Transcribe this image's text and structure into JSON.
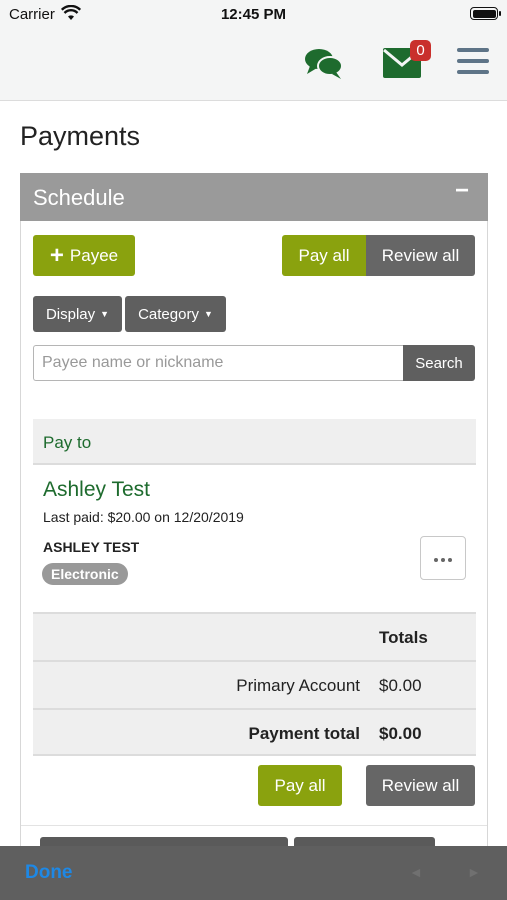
{
  "status_bar": {
    "carrier": "Carrier",
    "time": "12:45 PM"
  },
  "header": {
    "chat_icon": "chat-bubbles-icon",
    "mail_icon": "mail-icon",
    "mail_badge": "0",
    "menu_icon": "hamburger-menu-icon"
  },
  "page": {
    "title": "Payments"
  },
  "panel": {
    "title": "Schedule",
    "collapse_symbol": "−",
    "add_payee_label": "Payee",
    "pay_all_label": "Pay all",
    "review_all_label": "Review all",
    "display_label": "Display",
    "category_label": "Category",
    "search": {
      "placeholder": "Payee name or nickname",
      "button_label": "Search"
    }
  },
  "payees": {
    "header": "Pay to",
    "items": [
      {
        "name": "Ashley Test",
        "last_paid": "Last paid: $20.00 on 12/20/2019",
        "legal_name": "ASHLEY TEST",
        "method": "Electronic"
      }
    ]
  },
  "totals": {
    "header": "Totals",
    "rows": [
      {
        "label": "Primary Account",
        "value": "$0.00"
      },
      {
        "label": "Payment total",
        "value": "$0.00"
      }
    ]
  },
  "bottom_actions": {
    "pay_all_label": "Pay all",
    "review_all_label": "Review all"
  },
  "keyboard_toolbar": {
    "done_label": "Done",
    "prev_symbol": "◄",
    "next_symbol": "►"
  },
  "colors": {
    "accent_green": "#8aa20e",
    "brand_green": "#1e6b2e",
    "badge_red": "#c9302c",
    "done_blue": "#1e88e5"
  }
}
